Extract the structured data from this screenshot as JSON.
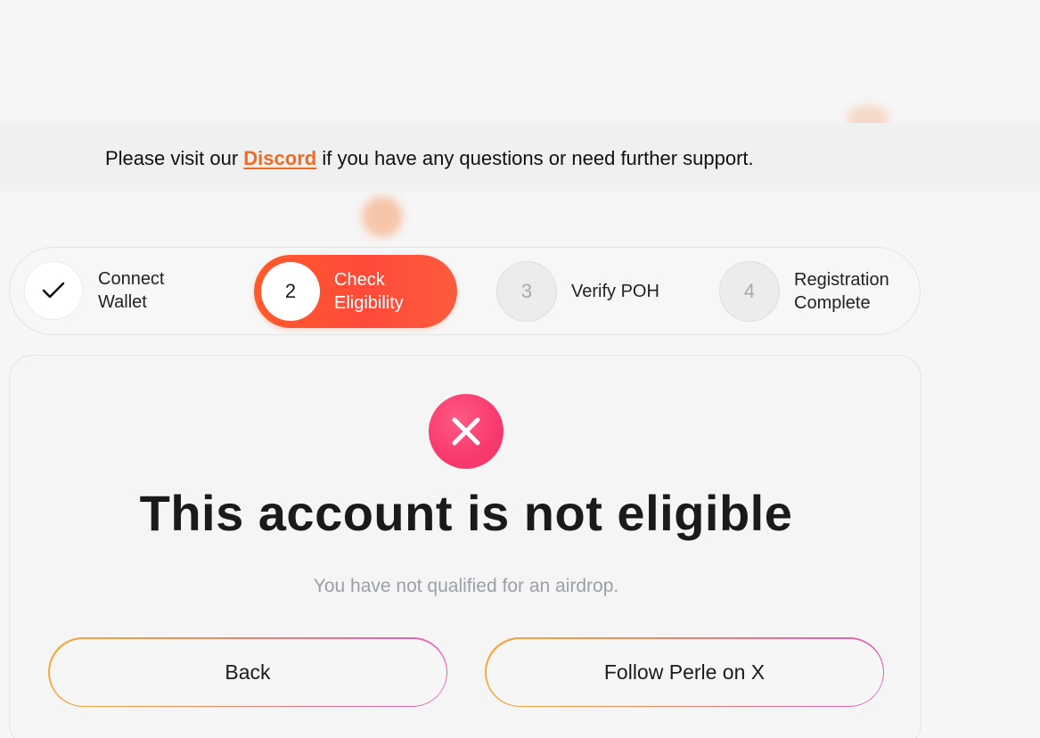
{
  "banner": {
    "text_before": "Please visit our ",
    "link_label": "Discord",
    "text_after": " if you have any questions or need further support."
  },
  "stepper": {
    "steps": [
      {
        "number": "",
        "label_line1": "Connect",
        "label_line2": "Wallet",
        "state": "completed",
        "icon": "check-icon"
      },
      {
        "number": "2",
        "label_line1": "Check",
        "label_line2": "Eligibility",
        "state": "active"
      },
      {
        "number": "3",
        "label_line1": "Verify POH",
        "label_line2": "",
        "state": "pending"
      },
      {
        "number": "4",
        "label_line1": "Registration",
        "label_line2": "Complete",
        "state": "pending"
      }
    ]
  },
  "result": {
    "icon": "close-icon",
    "title": "This account is not eligible",
    "subtitle": "You have not qualified for an airdrop."
  },
  "actions": {
    "back_label": "Back",
    "follow_label": "Follow Perle on X"
  },
  "colors": {
    "accent_orange": "#ff5a2c",
    "link_orange": "#f46a1e",
    "error_pink": "#f8396b",
    "muted_text": "#9aa0a8"
  }
}
